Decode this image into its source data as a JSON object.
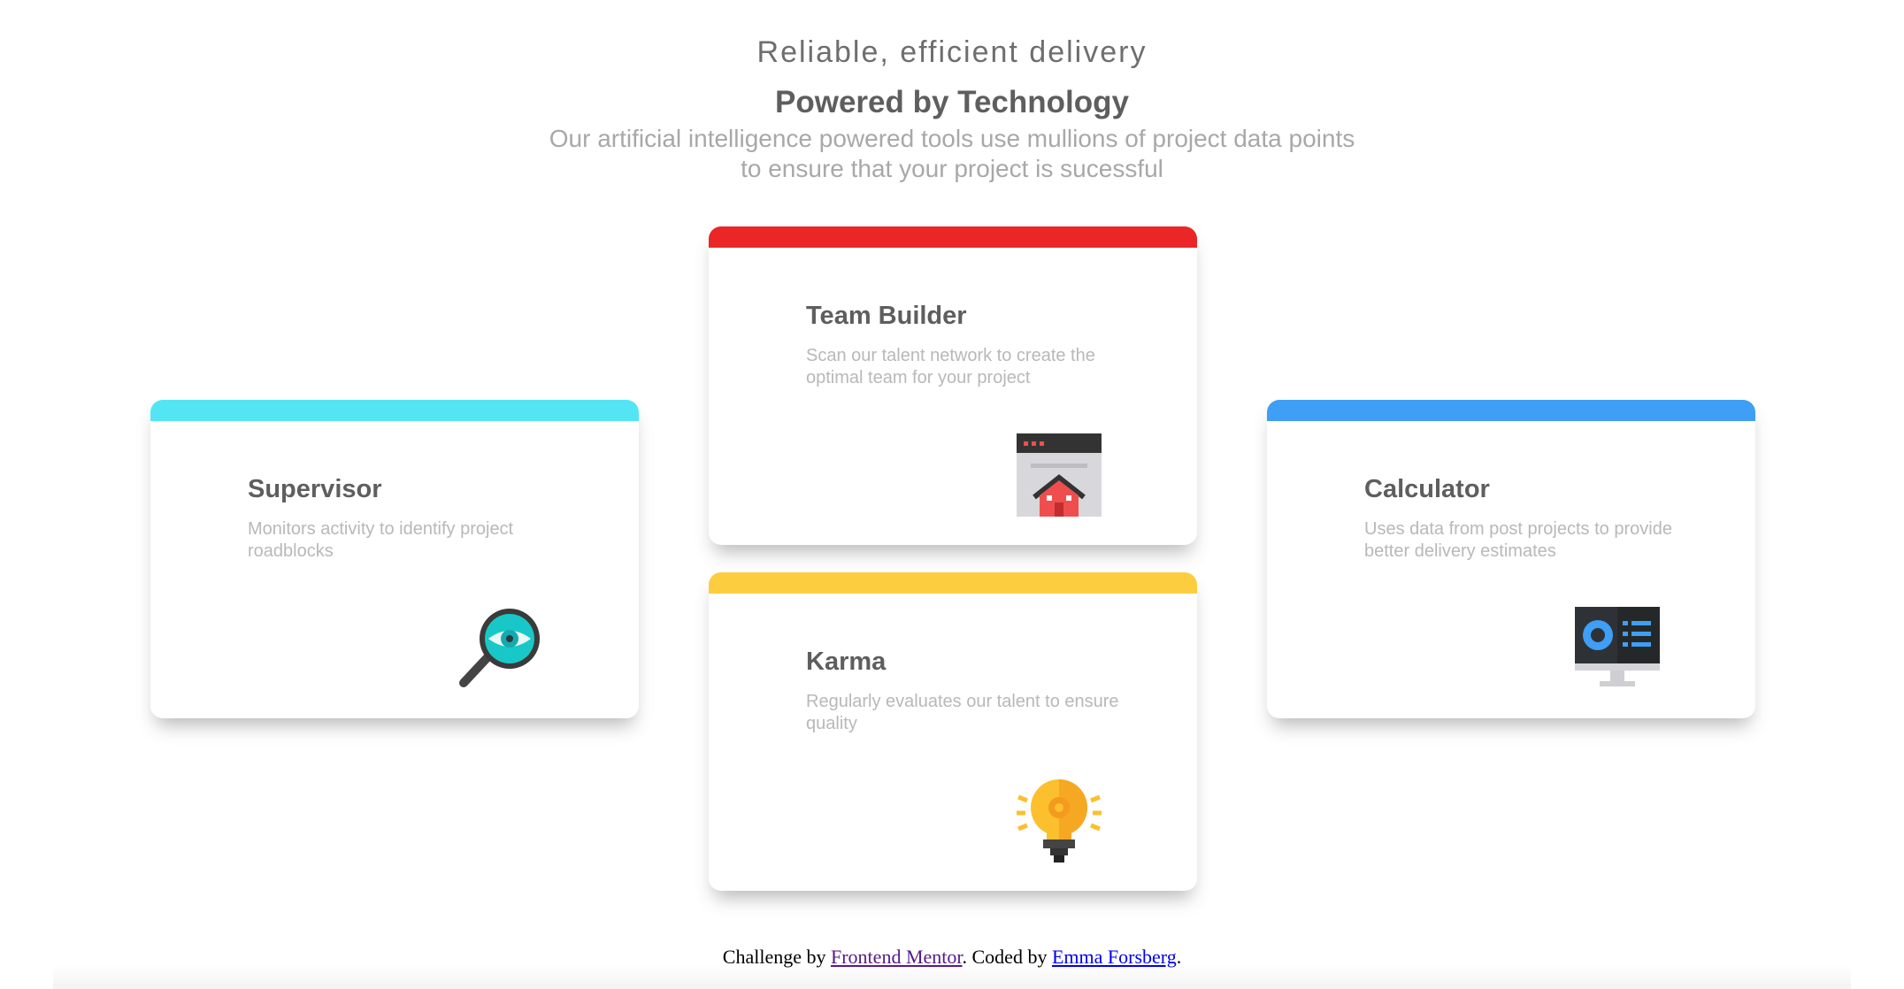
{
  "header": {
    "subtitle": "Reliable, efficient delivery",
    "title": "Powered by Technology",
    "description": "Our artificial intelligence powered tools use mullions of project data points to ensure that your project is sucessful"
  },
  "cards": {
    "supervisor": {
      "title": "Supervisor",
      "description": "Monitors activity to identify project roadblocks",
      "accent": "#54e5f5",
      "icon": "magnifier-eye-icon"
    },
    "team_builder": {
      "title": "Team Builder",
      "description": "Scan our talent network to create the optimal team for your project",
      "accent": "#ea2626",
      "icon": "browser-house-icon"
    },
    "karma": {
      "title": "Karma",
      "description": "Regularly evaluates our talent to ensure quality",
      "accent": "#fcce3f",
      "icon": "lightbulb-icon"
    },
    "calculator": {
      "title": "Calculator",
      "description": "Uses data from post projects to provide better delivery estimates",
      "accent": "#3f9ef5",
      "icon": "monitor-dashboard-icon"
    }
  },
  "footer": {
    "prefix": "Challenge by ",
    "link1": "Frontend Mentor",
    "middle": ". Coded by ",
    "link2": "Emma Forsberg",
    "suffix": "."
  }
}
